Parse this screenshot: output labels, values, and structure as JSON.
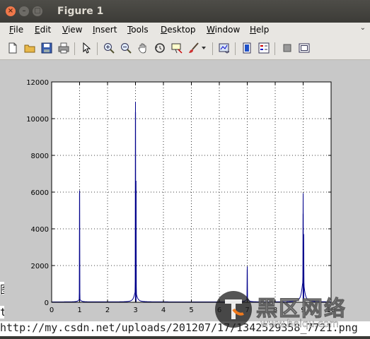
{
  "window": {
    "title": "Figure 1"
  },
  "menu": [
    "File",
    "Edit",
    "View",
    "Insert",
    "Tools",
    "Desktop",
    "Window",
    "Help"
  ],
  "toolbar_icons": [
    "new-figure-icon",
    "open-file-icon",
    "save-icon",
    "print-icon",
    "select-arrow-icon",
    "zoom-in-icon",
    "zoom-out-icon",
    "pan-hand-icon",
    "rotate-3d-icon",
    "data-cursor-icon",
    "brush-icon",
    "brush-dropdown-icon",
    "link-plot-icon",
    "colorbar-icon",
    "legend-icon",
    "hide-plot-tools-icon",
    "show-plot-tools-icon"
  ],
  "background_text": {
    "left_char_1": "图",
    "left_char_2": "t",
    "url": "http://my.csdn.net/uploads/201207/17/1342529358_7721.png"
  },
  "watermark": {
    "name": "黑区网络",
    "url": "www.heiqu.com"
  },
  "chart_data": {
    "type": "line",
    "xlim": [
      0,
      10
    ],
    "ylim": [
      0,
      12000
    ],
    "xticks": [
      "0",
      "1",
      "2",
      "3",
      "4",
      "5",
      "6",
      "7",
      "8",
      "9",
      "10"
    ],
    "yticks": [
      "0",
      "2000",
      "4000",
      "6000",
      "8000",
      "10000",
      "12000"
    ],
    "grid": "dotted",
    "series_color": "#00008b",
    "baseline": 20,
    "peaks": [
      {
        "x": 1.0,
        "y": 5950
      },
      {
        "x": 3.0,
        "y": 10350
      },
      {
        "x": 3.02,
        "y": 6100
      },
      {
        "x": 7.0,
        "y": 1780
      },
      {
        "x": 9.0,
        "y": 4820
      },
      {
        "x": 9.02,
        "y": 2700
      }
    ],
    "shoulders": [
      {
        "x": 3.0,
        "y": 550
      },
      {
        "x": 9.0,
        "y": 1100
      },
      {
        "x": 7.0,
        "y": 150
      },
      {
        "x": 1.0,
        "y": 120
      }
    ]
  }
}
